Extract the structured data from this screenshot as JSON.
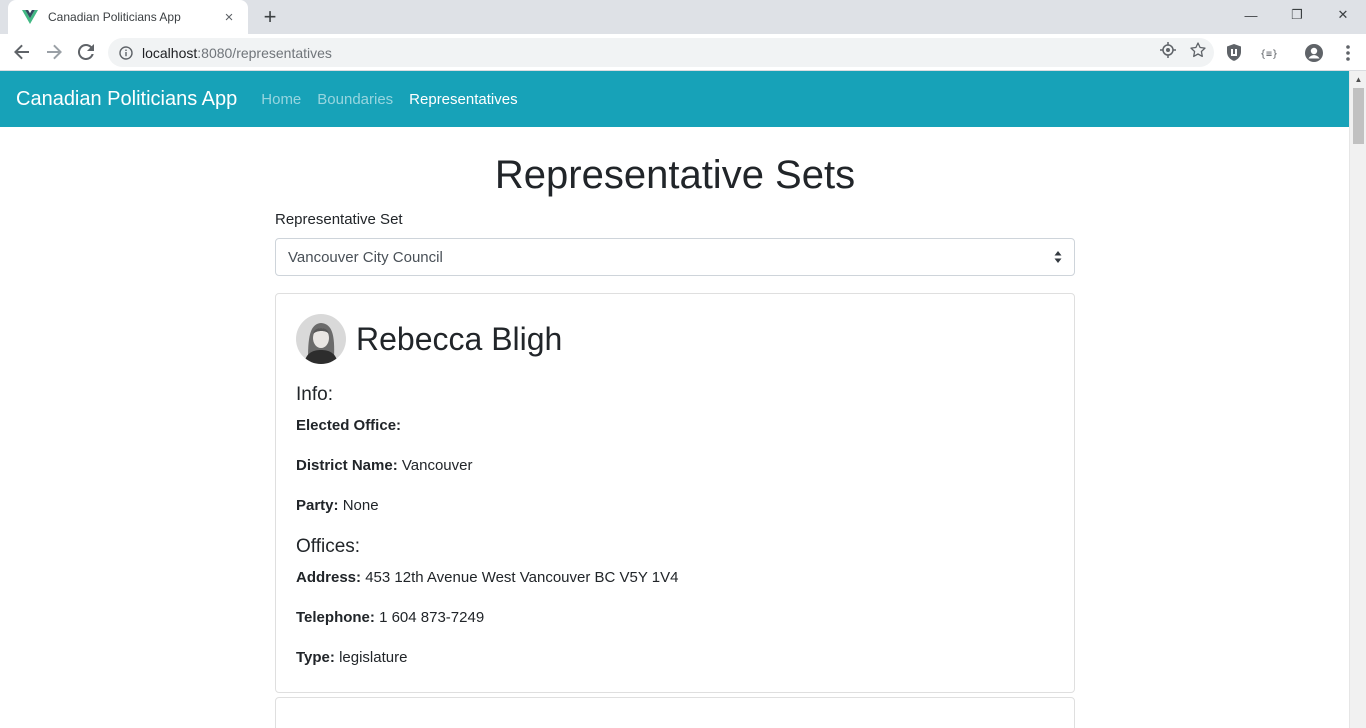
{
  "browser": {
    "tab_title": "Canadian Politicians App",
    "tab_close": "×",
    "new_tab": "+",
    "url_host": "localhost",
    "url_rest": ":8080/representatives",
    "window": {
      "minimize": "—",
      "restore": "❐",
      "close": "✕"
    }
  },
  "navbar": {
    "brand": "Canadian Politicians App",
    "links": [
      {
        "label": "Home",
        "active": false
      },
      {
        "label": "Boundaries",
        "active": false
      },
      {
        "label": "Representatives",
        "active": true
      }
    ],
    "color": "#17a2b8"
  },
  "page": {
    "title": "Representative Sets",
    "select_label": "Representative Set",
    "selected_set": "Vancouver City Council"
  },
  "representative": {
    "name": "Rebecca Bligh",
    "info_heading": "Info:",
    "elected_office_label": "Elected Office:",
    "elected_office_value": "",
    "district_label": "District Name:",
    "district_value": "Vancouver",
    "party_label": "Party:",
    "party_value": "None",
    "offices_heading": "Offices:",
    "address_label": "Address:",
    "address_value": "453 12th Avenue West Vancouver BC V5Y 1V4",
    "telephone_label": "Telephone:",
    "telephone_value": "1 604 873-7249",
    "type_label": "Type:",
    "type_value": "legislature"
  }
}
